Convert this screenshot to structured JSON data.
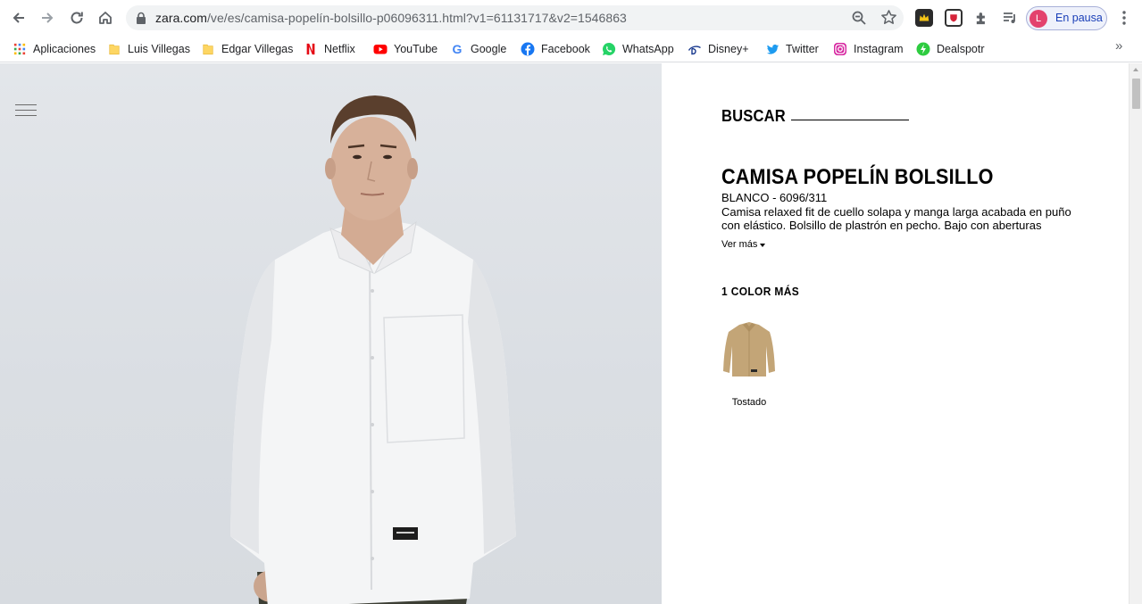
{
  "browser": {
    "url_main": "zara.com",
    "url_path": "/ve/es/camisa-popelín-bolsillo-p06096311.html?v1=61131717&v2=1546863",
    "profile_initial": "L",
    "profile_label": "En pausa"
  },
  "bookmarks": [
    {
      "label": "Aplicaciones",
      "icon": "apps-grid-icon"
    },
    {
      "label": "Luis Villegas",
      "icon": "folder-icon"
    },
    {
      "label": "Edgar Villegas",
      "icon": "folder-icon"
    },
    {
      "label": "Netflix",
      "icon": "netflix-icon"
    },
    {
      "label": "YouTube",
      "icon": "youtube-icon"
    },
    {
      "label": "Google",
      "icon": "google-icon"
    },
    {
      "label": "Facebook",
      "icon": "facebook-icon"
    },
    {
      "label": "WhatsApp",
      "icon": "whatsapp-icon"
    },
    {
      "label": "Disney+",
      "icon": "disney-icon"
    },
    {
      "label": "Twitter",
      "icon": "twitter-icon"
    },
    {
      "label": "Instagram",
      "icon": "instagram-icon"
    },
    {
      "label": "Dealspotr",
      "icon": "dealspotr-icon"
    }
  ],
  "bookmarks_more": "»",
  "product": {
    "search_label": "BUSCAR",
    "title": "CAMISA POPELÍN BOLSILLO",
    "ref": "BLANCO - 6096/311",
    "description": "Camisa relaxed fit de cuello solapa y manga larga acabada en puño con elástico. Bolsillo de plastrón en pecho. Bajo con aberturas",
    "ver_mas": "Ver más",
    "colors_label": "1 COLOR MÁS",
    "color_option": "Tostado"
  },
  "colors": {
    "shirt": "#f4f5f6",
    "pants": "#3d3f35",
    "alt_color": "#c3a577",
    "background": "#dfe2e6"
  }
}
